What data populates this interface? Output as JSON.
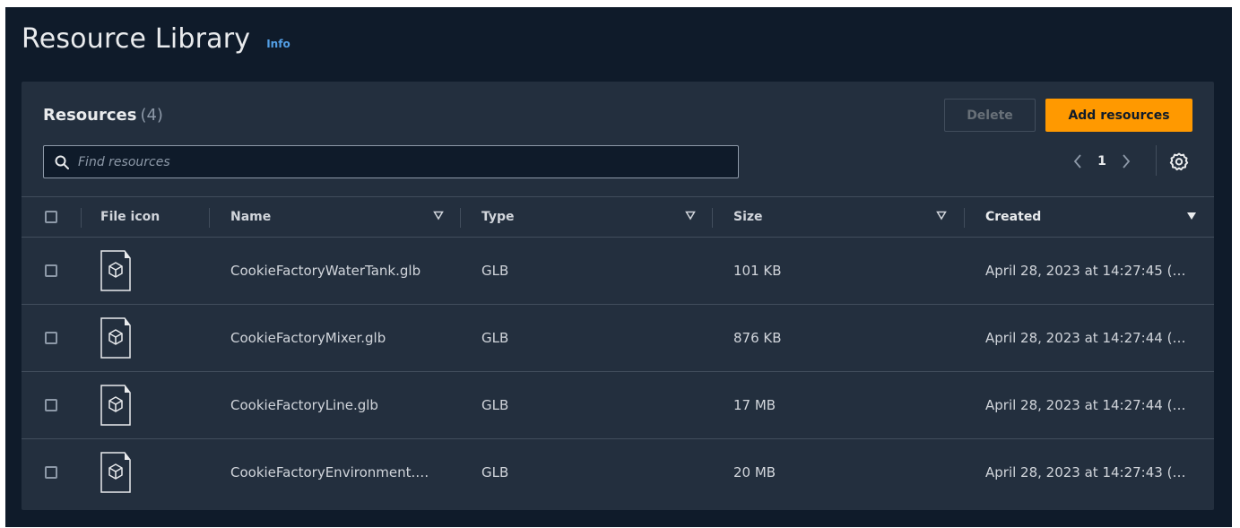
{
  "page": {
    "title": "Resource Library",
    "info_link": "Info"
  },
  "resources": {
    "title": "Resources",
    "count": "(4)",
    "delete_label": "Delete",
    "add_label": "Add resources",
    "search_placeholder": "Find resources",
    "search_value": "",
    "current_page": "1"
  },
  "table": {
    "columns": [
      "File icon",
      "Name",
      "Type",
      "Size",
      "Created"
    ],
    "sorted_column": "Created",
    "rows": [
      {
        "name": "CookieFactoryWaterTank.glb",
        "type": "GLB",
        "size": "101 KB",
        "created": "April 28, 2023 at 14:27:45 (…"
      },
      {
        "name": "CookieFactoryMixer.glb",
        "type": "GLB",
        "size": "876 KB",
        "created": "April 28, 2023 at 14:27:44 (…"
      },
      {
        "name": "CookieFactoryLine.glb",
        "type": "GLB",
        "size": "17 MB",
        "created": "April 28, 2023 at 14:27:44 (…"
      },
      {
        "name": "CookieFactoryEnvironment.…",
        "type": "GLB",
        "size": "20 MB",
        "created": "April 28, 2023 at 14:27:43 (…"
      }
    ]
  },
  "colors": {
    "page_bg": "#0f1b2a",
    "container_bg": "#232f3e",
    "accent": "#ff9900",
    "link": "#539fe5"
  },
  "icons": [
    "search-icon",
    "chevron-left-icon",
    "chevron-right-icon",
    "settings-gear-icon",
    "sort-caret-icon",
    "file-3d-model-icon"
  ]
}
